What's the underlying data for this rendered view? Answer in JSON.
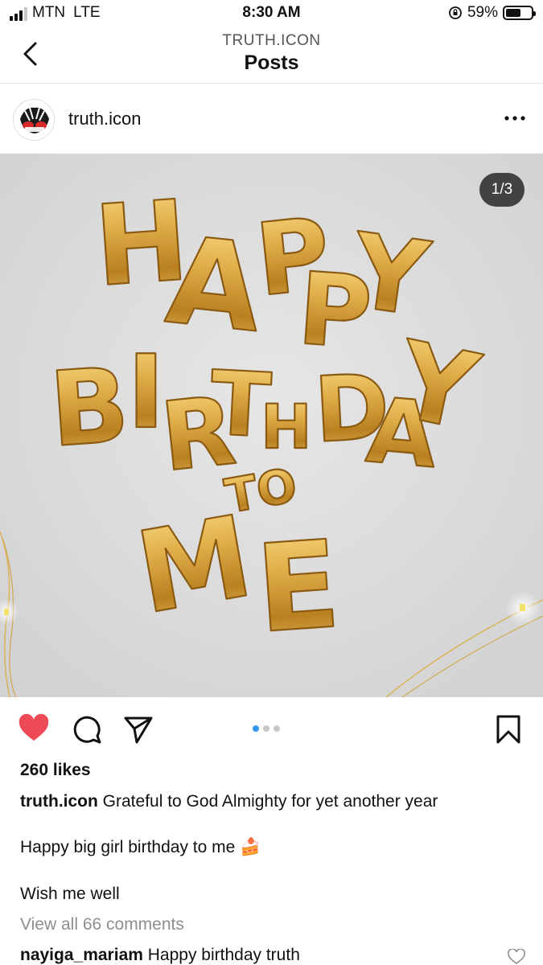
{
  "status_bar": {
    "carrier": "MTN",
    "network": "LTE",
    "time": "8:30 AM",
    "battery": "59%",
    "battery_level": 0.59,
    "signal_bars_active": 3,
    "signal_bars_total": 4
  },
  "nav": {
    "account": "TRUTH.ICON",
    "title": "Posts"
  },
  "post": {
    "username": "truth.icon",
    "avatar_text": "TRUTH ICON",
    "image": {
      "line1": "HAPPY",
      "line2": "BIRTHDAY",
      "line3": "TO",
      "line4": "ME",
      "counter": "1/3"
    },
    "carousel": {
      "current": 1,
      "total": 3
    },
    "liked": true,
    "likes": "260 likes",
    "caption": {
      "username": "truth.icon",
      "text": "Grateful to God Almighty for yet another year",
      "line2": "Happy big girl birthday to me 🍰",
      "line3": "Wish me well"
    },
    "view_all_comments": "View all 66 comments",
    "top_comment": {
      "username": "nayiga_mariam",
      "text": "Happy birthday truth"
    }
  },
  "colors": {
    "like_red": "#ed4956",
    "carousel_active": "#3797f0",
    "balloon_gold": "#d4a23a"
  }
}
